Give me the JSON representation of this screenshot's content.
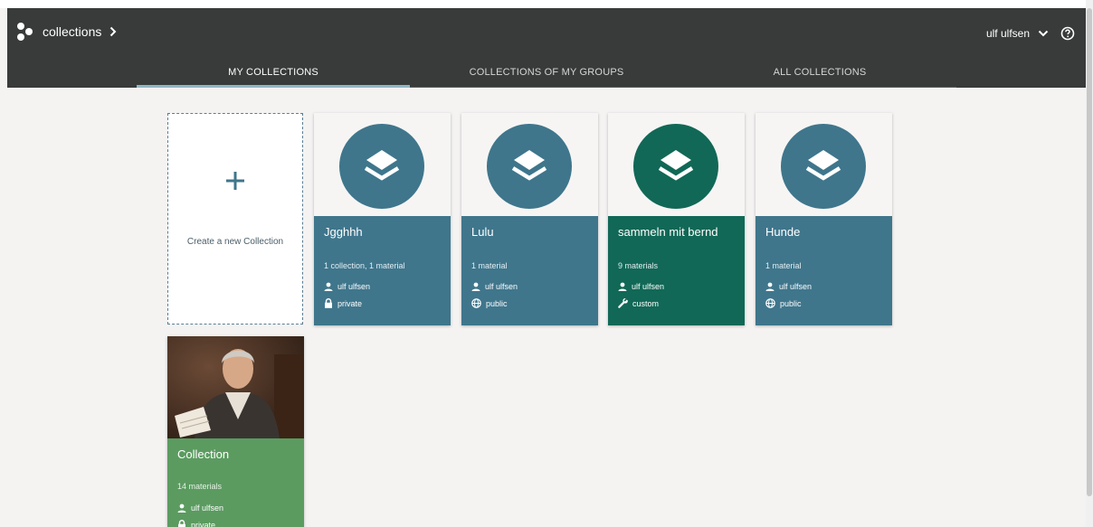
{
  "header": {
    "brand_label": "collections",
    "user_name": "ulf ulfsen"
  },
  "tabs": [
    {
      "label": "MY COLLECTIONS",
      "active": true
    },
    {
      "label": "COLLECTIONS OF MY GROUPS",
      "active": false
    },
    {
      "label": "ALL COLLECTIONS",
      "active": false
    }
  ],
  "create_card": {
    "label": "Create a new Collection"
  },
  "collections": [
    {
      "title": "Jgghhh",
      "meta": "1 collection, 1 material",
      "owner": "ulf ulfsen",
      "scope": "private",
      "color": "#3f768c",
      "scope_icon": "lock-icon"
    },
    {
      "title": "Lulu",
      "meta": "1 material",
      "owner": "ulf ulfsen",
      "scope": "public",
      "color": "#3f768c",
      "scope_icon": "globe-icon"
    },
    {
      "title": "sammeln mit bernd",
      "meta": "9 materials",
      "owner": "ulf ulfsen",
      "scope": "custom",
      "color": "#116856",
      "scope_icon": "wrench-icon"
    },
    {
      "title": "Hunde",
      "meta": "1 material",
      "owner": "ulf ulfsen",
      "scope": "public",
      "color": "#3f768c",
      "scope_icon": "globe-icon"
    }
  ],
  "photo_collection": {
    "title": "Collection",
    "meta": "14 materials",
    "owner": "ulf ulfsen",
    "scope": "private",
    "color": "#5b9b60",
    "scope_icon": "lock-icon"
  },
  "colors": {
    "header_bg": "#383b3a",
    "active_tab_underline": "#8fb6c4",
    "page_bg": "#f4f3f2"
  }
}
